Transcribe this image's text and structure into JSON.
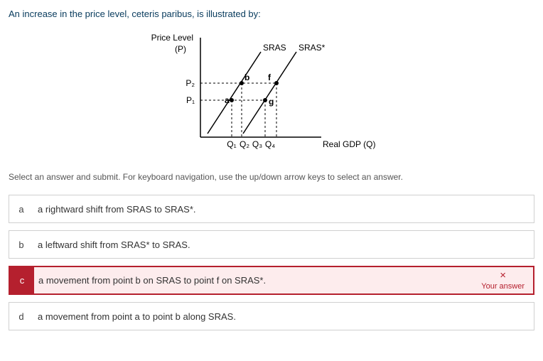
{
  "question": "An increase in the price level, ceteris paribus, is illustrated by:",
  "instructions": "Select an answer and submit. For keyboard navigation, use the up/down arrow keys to select an answer.",
  "answers": [
    {
      "letter": "a",
      "text": "a rightward shift from SRAS to SRAS*."
    },
    {
      "letter": "b",
      "text": "a leftward shift from SRAS* to SRAS."
    },
    {
      "letter": "c",
      "text": "a movement from point b on SRAS to point f on SRAS*."
    },
    {
      "letter": "d",
      "text": "a movement from point a to point b along SRAS."
    }
  ],
  "selected_feedback": {
    "icon": "×",
    "label": "Your answer"
  },
  "chart_data": {
    "type": "line",
    "title": "",
    "ylabel": "Price Level (P)",
    "xlabel": "Real GDP (Q)",
    "y_ticks": [
      "P₁",
      "P₂"
    ],
    "x_ticks": [
      "Q₁",
      "Q₂",
      "Q₃",
      "Q₄"
    ],
    "series": [
      {
        "name": "SRAS",
        "slope": "positive"
      },
      {
        "name": "SRAS*",
        "slope": "positive"
      }
    ],
    "points": [
      {
        "label": "a",
        "x": "Q₁",
        "y": "P₁",
        "on": "SRAS"
      },
      {
        "label": "b",
        "x": "Q₂",
        "y": "P₂",
        "on": "SRAS"
      },
      {
        "label": "g",
        "x": "Q₃",
        "y": "P₁",
        "on": "SRAS*"
      },
      {
        "label": "f",
        "x": "Q₄",
        "y": "P₂",
        "on": "SRAS*"
      }
    ]
  },
  "chart_labels": {
    "y_axis_top1": "Price Level",
    "y_axis_top2": "(P)",
    "x_axis_right": "Real GDP (Q)",
    "p1": "P₁",
    "p2": "P₂",
    "q1": "Q₁",
    "q2": "Q₂",
    "q3": "Q₃",
    "q4": "Q₄",
    "sras": "SRAS",
    "sras_star": "SRAS*",
    "pt_a": "a",
    "pt_b": "b",
    "pt_f": "f",
    "pt_g": "g"
  }
}
